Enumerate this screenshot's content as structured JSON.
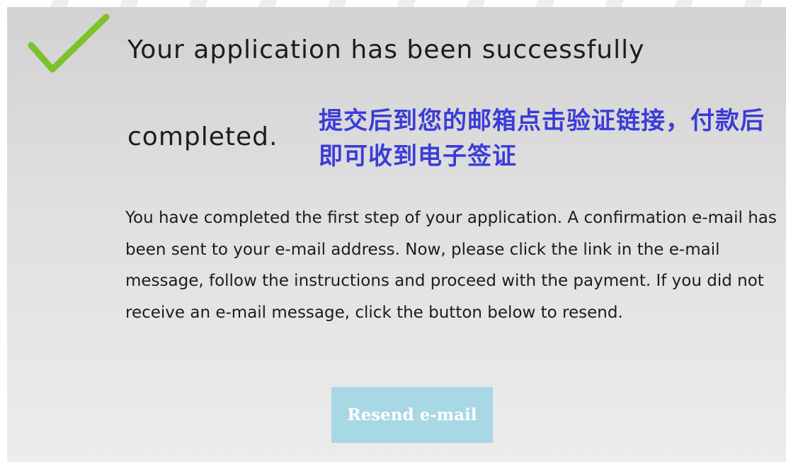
{
  "confirmation": {
    "title_line_1": "Your application has been successfully",
    "title_line_2": "completed.",
    "annotation_cn": "提交后到您的邮箱点击验证链接，付款后即可收到电子签证",
    "message": "You have completed the first step of your application. A confirmation e-mail has been sent to your e-mail address. Now, please click the link in the e-mail message, follow the instructions and proceed with the payment. If you did not receive an e-mail message, click the button below to resend.",
    "resend_button_label": "Resend e-mail"
  },
  "icons": {
    "success": "checkmark-icon"
  },
  "colors": {
    "checkmark": "#7cc22a",
    "annotation": "#3b3cd8",
    "button_bg": "#a7d8e4",
    "button_text": "#ffffff",
    "panel_bg": "#d9d9d9"
  }
}
